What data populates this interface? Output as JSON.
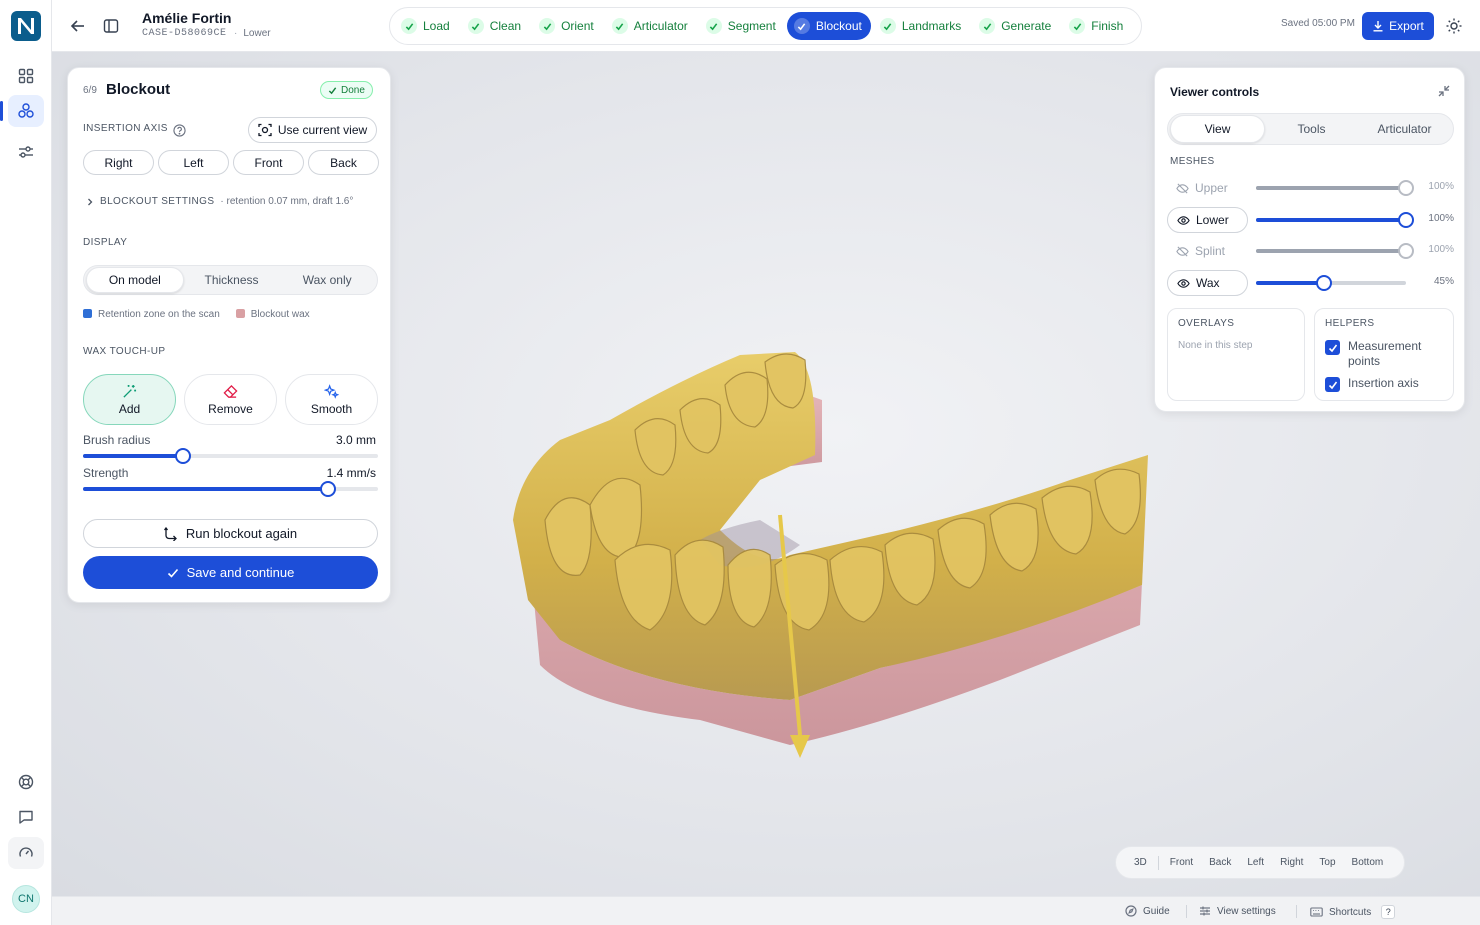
{
  "rail": {
    "logo_icon": "n-logo-icon",
    "items": [
      "grid-icon",
      "teeth-model-icon",
      "sliders-icon"
    ],
    "bottom_items": [
      "lifebuoy-icon",
      "chat-icon",
      "gauge-icon"
    ],
    "avatar_initials": "CN"
  },
  "header": {
    "patient_name": "Amélie Fortin",
    "case_id": "CASE-D58069CE",
    "jaw": "Lower",
    "saved_text": "Saved 05:00 PM",
    "export_label": "Export"
  },
  "steps": [
    {
      "label": "Load",
      "done": true,
      "active": false
    },
    {
      "label": "Clean",
      "done": true,
      "active": false
    },
    {
      "label": "Orient",
      "done": true,
      "active": false
    },
    {
      "label": "Articulator",
      "done": true,
      "active": false
    },
    {
      "label": "Segment",
      "done": true,
      "active": false
    },
    {
      "label": "Blockout",
      "done": true,
      "active": true
    },
    {
      "label": "Landmarks",
      "done": true,
      "active": false
    },
    {
      "label": "Generate",
      "done": true,
      "active": false
    },
    {
      "label": "Finish",
      "done": true,
      "active": false
    }
  ],
  "panel": {
    "step_number": "6/9",
    "title": "Blockout",
    "status_badge": "Done",
    "insertion_axis_label": "INSERTION AXIS",
    "use_current_view": "Use current view",
    "axis_buttons": [
      "Right",
      "Left",
      "Front",
      "Back"
    ],
    "blockout_settings_label": "BLOCKOUT SETTINGS",
    "blockout_settings_summary": "· retention 0.07 mm, draft 1.6°",
    "display_label": "DISPLAY",
    "display_options": [
      "On model",
      "Thickness",
      "Wax only"
    ],
    "display_selected": "On model",
    "legend": [
      {
        "label": "Retention zone on the scan",
        "color": "#2f6fd6"
      },
      {
        "label": "Blockout wax",
        "color": "#d9a0a3"
      }
    ],
    "wax_touchup_label": "WAX TOUCH-UP",
    "tools": [
      {
        "label": "Add",
        "icon": "wand-icon",
        "color": "#0f9d76",
        "selected": true
      },
      {
        "label": "Remove",
        "icon": "eraser-icon",
        "color": "#e11d48",
        "selected": false
      },
      {
        "label": "Smooth",
        "icon": "sparkles-icon",
        "color": "#2563eb",
        "selected": false
      }
    ],
    "brush_radius": {
      "label": "Brush radius",
      "value_text": "3.0 mm",
      "fraction": 0.34
    },
    "strength": {
      "label": "Strength",
      "value_text": "1.4 mm/s",
      "fraction": 0.83
    },
    "run_again": "Run blockout again",
    "save_continue": "Save and continue"
  },
  "viewer": {
    "title": "Viewer controls",
    "tabs": [
      "View",
      "Tools",
      "Articulator"
    ],
    "active_tab": "View",
    "meshes_label": "MESHES",
    "meshes": [
      {
        "name": "Upper",
        "visible": false,
        "opacity_text": "100%",
        "opacity": 1.0
      },
      {
        "name": "Lower",
        "visible": true,
        "opacity_text": "100%",
        "opacity": 1.0
      },
      {
        "name": "Splint",
        "visible": false,
        "opacity_text": "100%",
        "opacity": 1.0
      },
      {
        "name": "Wax",
        "visible": true,
        "opacity_text": "45%",
        "opacity": 0.45
      }
    ],
    "overlays_label": "OVERLAYS",
    "overlays_empty": "None in this step",
    "helpers_label": "HELPERS",
    "helpers": [
      {
        "label": "Measurement points",
        "checked": true
      },
      {
        "label": "Insertion axis",
        "checked": true
      }
    ]
  },
  "view_presets": [
    "3D",
    "Front",
    "Back",
    "Left",
    "Right",
    "Top",
    "Bottom"
  ],
  "statusbar": {
    "guide": "Guide",
    "view_settings": "View settings",
    "shortcuts": "Shortcuts",
    "shortcut_key": "?"
  },
  "colors": {
    "accent": "#1d4ed8",
    "success": "#15803d",
    "tooth": "#d4b24a",
    "wax": "#d9a0a3"
  }
}
